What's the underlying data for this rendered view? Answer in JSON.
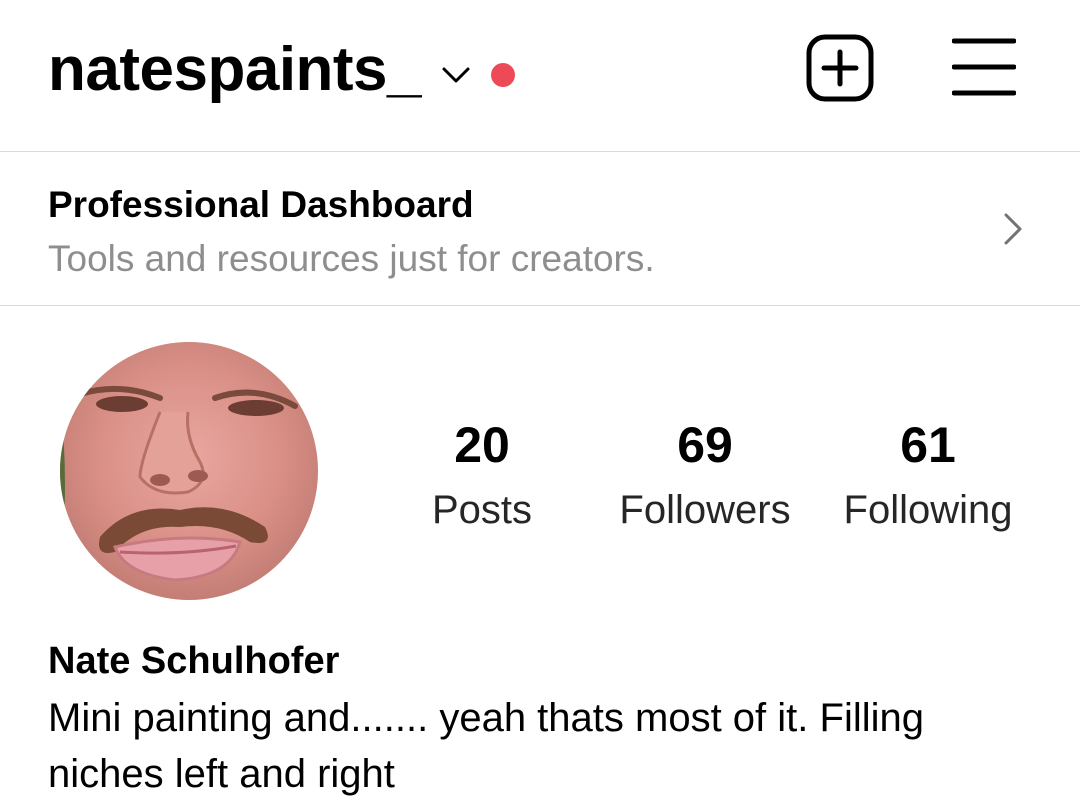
{
  "header": {
    "username": "natespaints_",
    "icons": {
      "switch_account": "chevron-down-icon",
      "notification": "notification-dot",
      "create": "plus-square-icon",
      "menu": "hamburger-menu-icon"
    },
    "notification_color": "#ed4956"
  },
  "dashboard": {
    "title": "Professional Dashboard",
    "subtitle": "Tools and resources just for creators.",
    "icon": "chevron-right-icon"
  },
  "profile": {
    "avatar_icon": "profile-photo",
    "stats": {
      "posts": {
        "value": "20",
        "label": "Posts"
      },
      "followers": {
        "value": "69",
        "label": "Followers"
      },
      "following": {
        "value": "61",
        "label": "Following"
      }
    },
    "full_name": "Nate Schulhofer",
    "bio": "Mini painting and....... yeah thats most of it. Filling niches left and right"
  },
  "colors": {
    "text": "#000000",
    "muted": "#8e8e8e",
    "divider": "#dbdbdb",
    "accent_red": "#ed4956"
  }
}
